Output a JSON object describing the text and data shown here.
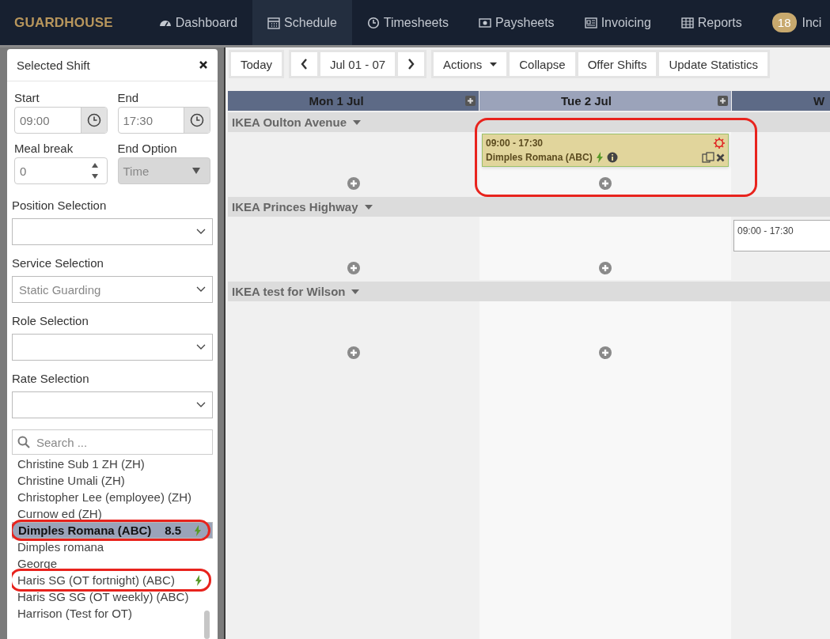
{
  "nav": {
    "logo": "GUARDHOUSE",
    "items": [
      {
        "label": "Dashboard",
        "selected": false
      },
      {
        "label": "Schedule",
        "selected": true
      },
      {
        "label": "Timesheets",
        "selected": false
      },
      {
        "label": "Paysheets",
        "selected": false
      },
      {
        "label": "Invoicing",
        "selected": false
      },
      {
        "label": "Reports",
        "selected": false
      },
      {
        "label": "Inci",
        "badge": "18",
        "selected": false
      }
    ]
  },
  "panel": {
    "title": "Selected Shift",
    "start": {
      "label": "Start",
      "value": "09:00"
    },
    "end": {
      "label": "End",
      "value": "17:30"
    },
    "meal_break": {
      "label": "Meal break",
      "value": "0"
    },
    "end_option": {
      "label": "End Option",
      "value": "Time",
      "disabled": true
    },
    "selects": [
      {
        "label": "Position Selection"
      },
      {
        "label": "Service Selection",
        "value": "Static Guarding"
      },
      {
        "label": "Role Selection"
      },
      {
        "label": "Rate Selection"
      }
    ],
    "search": {
      "placeholder": "Search ..."
    },
    "employees": [
      {
        "name": "Christine Sub 1 ZH (ZH)",
        "selected": false
      },
      {
        "name": "Christine Umali (ZH)",
        "selected": false
      },
      {
        "name": "Christopher Lee (employee) (ZH)",
        "selected": false
      },
      {
        "name": "Curnow ed (ZH)",
        "selected": false
      },
      {
        "name": "Dimples Romana (ABC)",
        "hours": "8.5",
        "selected": true,
        "available": true,
        "annotated": true
      },
      {
        "name": "Dimples romana",
        "selected": false
      },
      {
        "name": "George",
        "selected": false
      },
      {
        "name": "Haris SG (OT fortnight) (ABC)",
        "selected": false,
        "available": true,
        "annotated": true
      },
      {
        "name": "Haris SG SG (OT weekly) (ABC)",
        "selected": false
      },
      {
        "name": "Harrison (Test for OT)",
        "selected": false
      }
    ]
  },
  "toolbar": [
    [
      {
        "kind": "button",
        "label": "Today"
      }
    ],
    [
      {
        "kind": "prev"
      },
      {
        "kind": "button",
        "label": "Jul 01 - 07"
      },
      {
        "kind": "next"
      }
    ],
    [
      {
        "kind": "dropdown",
        "label": "Actions"
      },
      {
        "kind": "button",
        "label": "Collapse"
      },
      {
        "kind": "button",
        "label": "Offer Shifts"
      },
      {
        "kind": "button",
        "label": "Update Statistics"
      }
    ]
  ],
  "days": [
    {
      "label": "Mon 1 Jul",
      "selected": false
    },
    {
      "label": "Tue 2 Jul",
      "selected": true
    },
    {
      "label": "W",
      "selected": false
    }
  ],
  "sites": [
    {
      "name": "IKEA Oulton Avenue",
      "cells": [
        {
          "add": true
        },
        {
          "add": true,
          "annotated": true,
          "shifts": [
            {
              "kind": "assigned",
              "time": "09:00 - 17:30",
              "employee": "Dimples Romana (ABC)"
            }
          ]
        },
        {}
      ]
    },
    {
      "name": "IKEA Princes Highway",
      "cells": [
        {
          "add": true
        },
        {
          "add": true
        },
        {
          "shifts": [
            {
              "kind": "open",
              "time": "09:00 - 17:30"
            }
          ]
        }
      ]
    },
    {
      "name": "IKEA test for Wilson",
      "cells": [
        {
          "add": true
        },
        {
          "add": true
        },
        {}
      ]
    }
  ]
}
